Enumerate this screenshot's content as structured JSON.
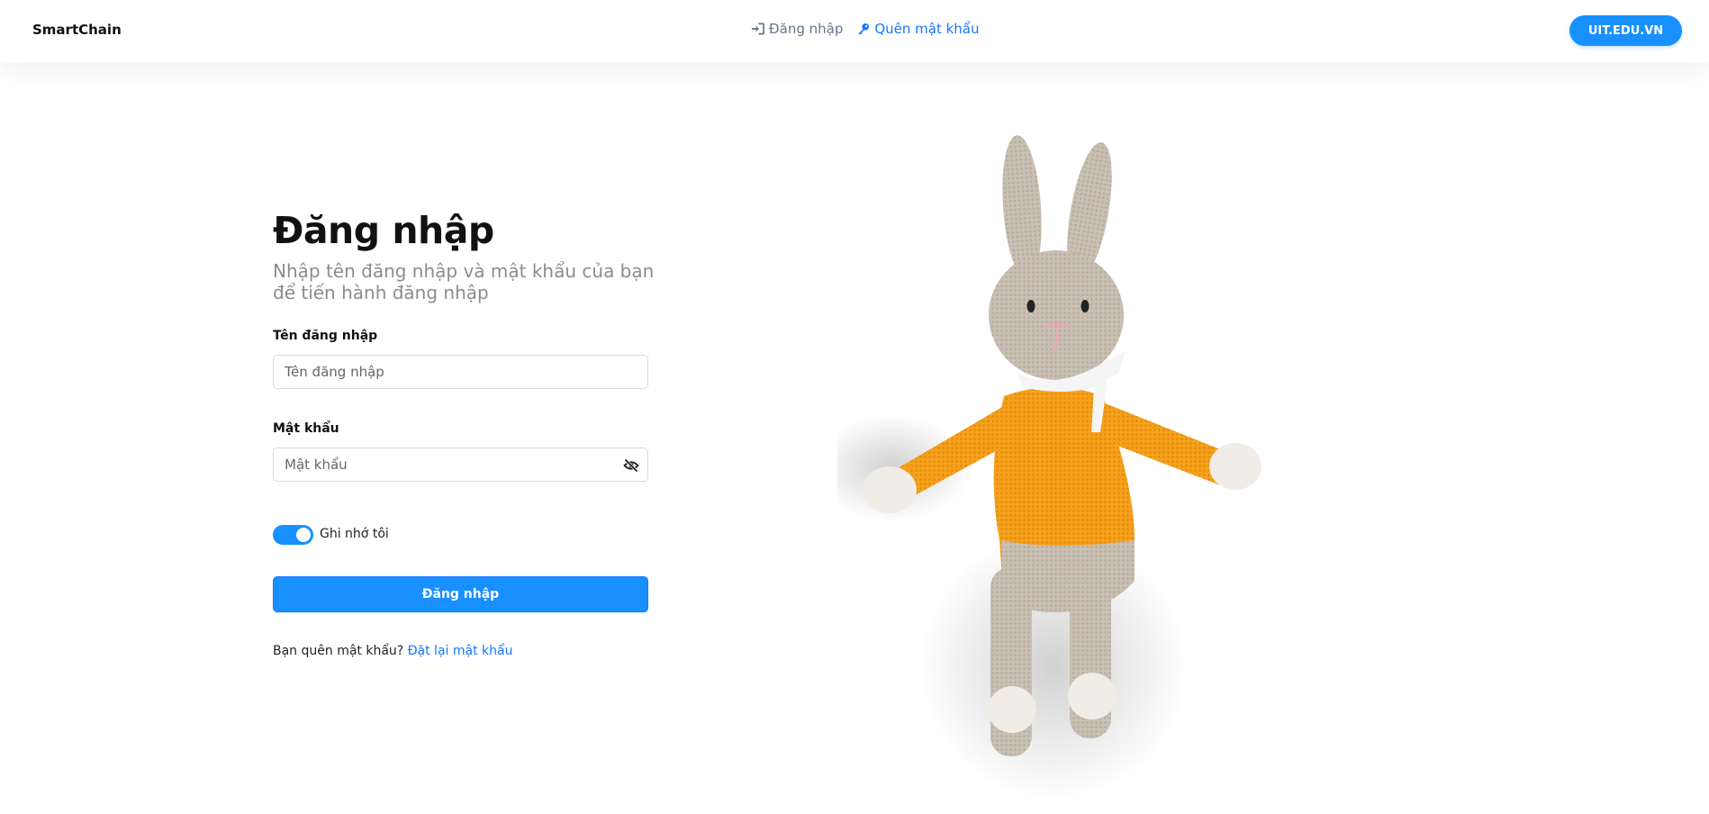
{
  "navbar": {
    "brand": "SmartChain",
    "links": [
      {
        "label": "Đăng nhập",
        "icon": "sign-in-icon"
      },
      {
        "label": "Quên mật khẩu",
        "icon": "key-icon"
      }
    ],
    "button_label": "UIT.EDU.VN"
  },
  "login": {
    "title": "Đăng nhập",
    "subtitle": "Nhập tên đăng nhập và mật khẩu của bạn để tiến hành đăng nhập",
    "username": {
      "label": "Tên đăng nhập",
      "placeholder": "Tên đăng nhập",
      "value": ""
    },
    "password": {
      "label": "Mật khẩu",
      "placeholder": "Mật khẩu",
      "value": "",
      "toggle_icon": "eye-slash-icon"
    },
    "remember": {
      "label": "Ghi nhớ tôi",
      "checked": true
    },
    "submit_label": "Đăng nhập",
    "forgot_text": "Bạn quên mật khẩu?",
    "reset_link": "Đặt lại mật khẩu"
  },
  "illustration": {
    "subject": "crochet-bunny-image"
  },
  "colors": {
    "accent": "#1890ff",
    "link": "#1677ff",
    "bunny_body": "#f6a01a",
    "bunny_knit": "#c8beb2"
  }
}
